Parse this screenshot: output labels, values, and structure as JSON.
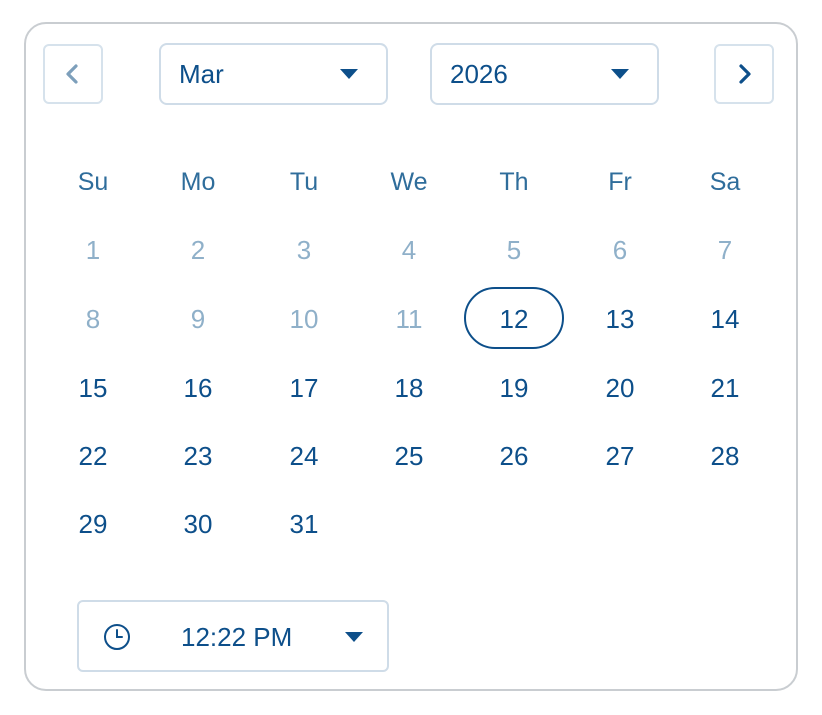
{
  "header": {
    "prev_icon": "chevron-left-icon",
    "next_icon": "chevron-right-icon",
    "month": "Mar",
    "year": "2026"
  },
  "weekdays": [
    "Su",
    "Mo",
    "Tu",
    "We",
    "Th",
    "Fr",
    "Sa"
  ],
  "weeks": [
    [
      {
        "label": "1",
        "disabled": true
      },
      {
        "label": "2",
        "disabled": true
      },
      {
        "label": "3",
        "disabled": true
      },
      {
        "label": "4",
        "disabled": true
      },
      {
        "label": "5",
        "disabled": true
      },
      {
        "label": "6",
        "disabled": true
      },
      {
        "label": "7",
        "disabled": true
      }
    ],
    [
      {
        "label": "8",
        "disabled": true
      },
      {
        "label": "9",
        "disabled": true
      },
      {
        "label": "10",
        "disabled": true
      },
      {
        "label": "11",
        "disabled": true
      },
      {
        "label": "12",
        "selected": true
      },
      {
        "label": "13"
      },
      {
        "label": "14"
      }
    ],
    [
      {
        "label": "15"
      },
      {
        "label": "16"
      },
      {
        "label": "17"
      },
      {
        "label": "18"
      },
      {
        "label": "19"
      },
      {
        "label": "20"
      },
      {
        "label": "21"
      }
    ],
    [
      {
        "label": "22"
      },
      {
        "label": "23"
      },
      {
        "label": "24"
      },
      {
        "label": "25"
      },
      {
        "label": "26"
      },
      {
        "label": "27"
      },
      {
        "label": "28"
      }
    ],
    [
      {
        "label": "29"
      },
      {
        "label": "30"
      },
      {
        "label": "31"
      }
    ]
  ],
  "time": {
    "icon": "clock-icon",
    "value": "12:22 PM"
  },
  "colors": {
    "primary": "#0d4f8a",
    "disabled": "#8fb0c9",
    "weekday": "#2f6d9b",
    "border": "#c9cdd1"
  }
}
